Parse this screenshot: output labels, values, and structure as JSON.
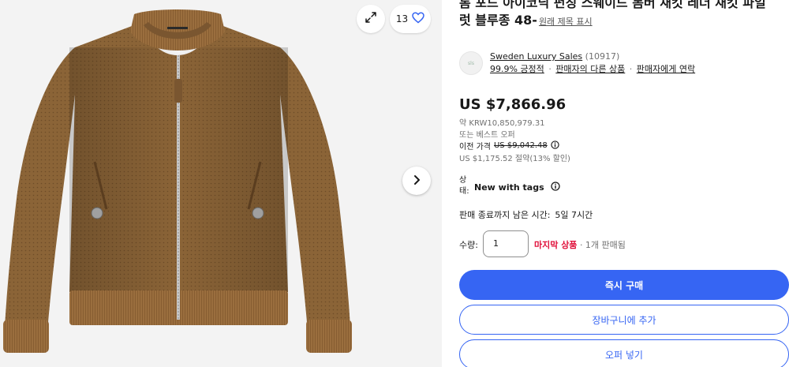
{
  "gallery": {
    "image_count": "13",
    "image_alt": "Suede bomber jacket"
  },
  "listing": {
    "title_line1": "톰 포드 아이코닉 펀칭 스웨이드 봄버 재킷 레더 재킷 파일",
    "title_line2": "럿 블루종 48-",
    "original_title_link": "원래 제목 표시"
  },
  "seller": {
    "name": "Sweden Luxury Sales",
    "feedback_count": "(10917)",
    "positive": "99.9% 긍정적",
    "other_items": "판매자의 다른 상품",
    "contact": "판매자에게 연락",
    "separator": "·",
    "logo_text": "sls"
  },
  "pricing": {
    "price": "US $7,866.96",
    "approx_prefix": "약",
    "approx_value": "KRW10,850,979.31",
    "best_offer": "또는 베스트 오퍼",
    "previous_label": "이전 가격",
    "previous_value": "US $9,042.48",
    "savings": "US $1,175.52 절약(13% 할인)"
  },
  "condition": {
    "label": "상태:",
    "value": "New with tags"
  },
  "ends": {
    "label": "판매 종료까지 남은 시간:",
    "value": "5일 7시간"
  },
  "quantity": {
    "label": "수량:",
    "value": "1",
    "last_item": "마지막 상품",
    "sold": "· 1개 판매됨"
  },
  "actions": {
    "buy_now": "즉시 구매",
    "add_to_cart": "장바구니에 추가",
    "make_offer": "오퍼 넣기"
  },
  "colors": {
    "primary": "#3665f3",
    "last_item": "#e0103a",
    "jacket": "#8a6335"
  },
  "icons": {
    "expand": "expand-icon",
    "heart": "heart-icon",
    "next": "chevron-right-icon",
    "info": "info-icon"
  }
}
